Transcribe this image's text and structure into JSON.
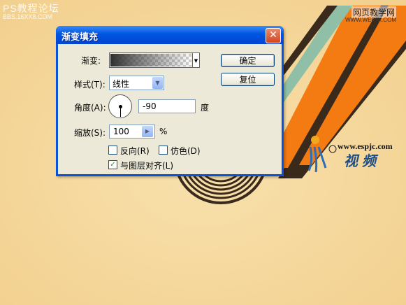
{
  "watermark": {
    "site_title": "PS教程论坛",
    "site_url": "BBS.16XX8.COM",
    "top_right_title": "网页教学网",
    "top_right_url": "WWW.WEBJX.COM"
  },
  "brand": {
    "url": "www.espjc.com",
    "name": "视频"
  },
  "dialog": {
    "title": "渐变填充",
    "close_glyph": "✕",
    "gradient_label": "渐变:",
    "style_label": "样式(T):",
    "style_value": "线性",
    "angle_label": "角度(A):",
    "angle_value": "-90",
    "angle_unit": "度",
    "scale_label": "缩放(S):",
    "scale_value": "100",
    "scale_unit": "%",
    "reverse_label": "反向(R)",
    "reverse_checked": false,
    "dither_label": "仿色(D)",
    "dither_checked": false,
    "align_label": "与图层对齐(L)",
    "align_checked": true,
    "ok_label": "确定",
    "reset_label": "复位"
  },
  "colors": {
    "background": "#f6dca4",
    "stripe_dark": "#3a2a1c",
    "stripe_orange": "#f47a12",
    "stripe_teal": "#8fbfa6",
    "xp_blue": "#0054e3"
  }
}
